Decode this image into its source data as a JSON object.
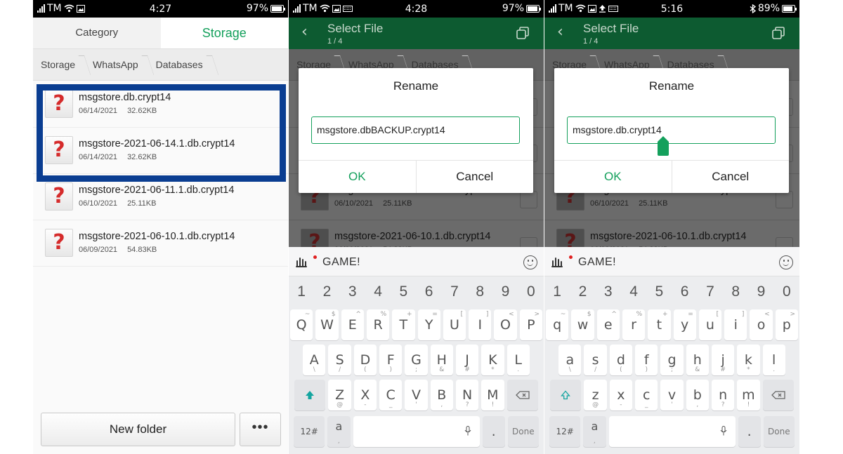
{
  "status": [
    {
      "carrier": "TM",
      "time": "4:27",
      "battery": "97%"
    },
    {
      "carrier": "TM",
      "time": "4:28",
      "battery": "97%"
    },
    {
      "carrier": "TM",
      "time": "5:16",
      "battery": "89%"
    }
  ],
  "tabs": {
    "category": "Category",
    "storage": "Storage"
  },
  "crumbs": [
    "Storage",
    "WhatsApp",
    "Databases"
  ],
  "files": [
    {
      "name": "msgstore.db.crypt14",
      "date": "06/14/2021",
      "size": "32.62KB"
    },
    {
      "name": "msgstore-2021-06-14.1.db.crypt14",
      "date": "06/14/2021",
      "size": "32.62KB"
    },
    {
      "name": "msgstore-2021-06-11.1.db.crypt14",
      "date": "06/10/2021",
      "size": "25.11KB"
    },
    {
      "name": "msgstore-2021-06-10.1.db.crypt14",
      "date": "06/09/2021",
      "size": "54.83KB"
    }
  ],
  "icon_glyph": "?",
  "bottom": {
    "new_folder": "New folder",
    "more": "•••"
  },
  "select_file": {
    "title": "Select File",
    "count": "1 / 4"
  },
  "dialogs": [
    {
      "title": "Rename",
      "value": "msgstore.dbBACKUP.crypt14",
      "ok": "OK",
      "cancel": "Cancel"
    },
    {
      "title": "Rename",
      "value": "msgstore.db.crypt14",
      "ok": "OK",
      "cancel": "Cancel"
    }
  ],
  "keyboard": {
    "brand": "GAME!",
    "numbers": [
      "1",
      "2",
      "3",
      "4",
      "5",
      "6",
      "7",
      "8",
      "9",
      "0"
    ],
    "rows_upper": [
      [
        "Q",
        "W",
        "E",
        "R",
        "T",
        "Y",
        "U",
        "I",
        "O",
        "P"
      ],
      [
        "A",
        "S",
        "D",
        "F",
        "G",
        "H",
        "J",
        "K",
        "L"
      ],
      [
        "Z",
        "X",
        "C",
        "V",
        "B",
        "N",
        "M"
      ]
    ],
    "rows_lower": [
      [
        "q",
        "w",
        "e",
        "r",
        "t",
        "y",
        "u",
        "i",
        "o",
        "p"
      ],
      [
        "a",
        "s",
        "d",
        "f",
        "g",
        "h",
        "j",
        "k",
        "l"
      ],
      [
        "z",
        "x",
        "c",
        "v",
        "b",
        "n",
        "m"
      ]
    ],
    "row1_alt": [
      "~",
      "$",
      "^",
      "%",
      "+",
      "=",
      "[",
      "]",
      "<",
      ">"
    ],
    "row2_alt": [
      "\\",
      "/",
      "(",
      ")",
      ";",
      "&",
      "#",
      "*",
      "."
    ],
    "row3_alt": [
      "@",
      "-",
      "_",
      "'",
      ",",
      "?",
      "!"
    ],
    "sym": "12#",
    "a_label": "a",
    "a_sub": ",",
    "period": ".",
    "done": "Done"
  },
  "colors": {
    "accent": "#14a05c",
    "appbar": "#0d5b31",
    "highlight": "#0a3d91",
    "error_icon": "#d52b2b"
  }
}
